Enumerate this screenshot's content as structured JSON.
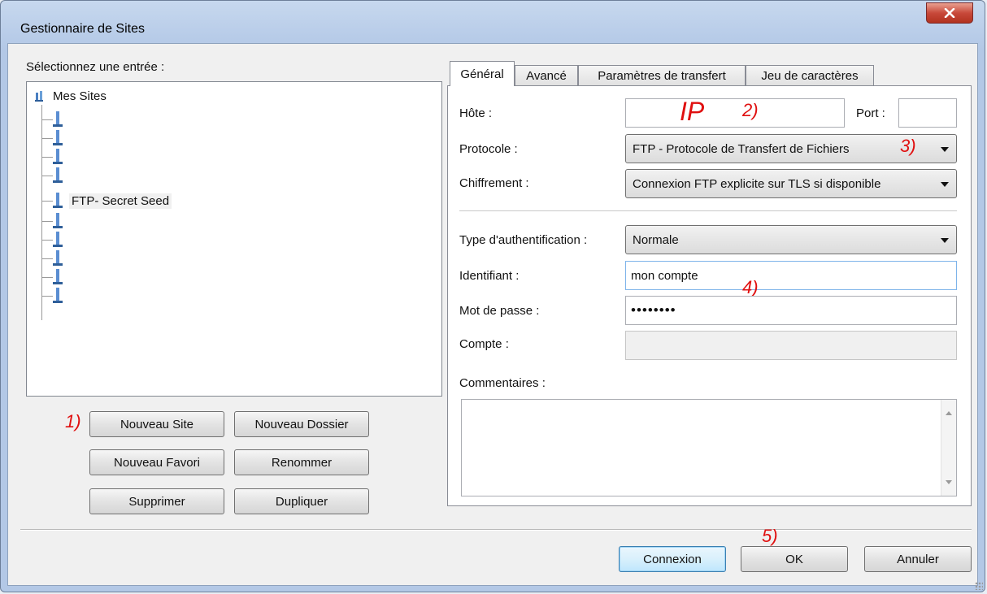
{
  "window": {
    "title": "Gestionnaire de Sites"
  },
  "left": {
    "select_label": "Sélectionnez une entrée :",
    "tree": {
      "root": "Mes Sites",
      "items": [
        "",
        "",
        "",
        "",
        "FTP- Secret Seed",
        "",
        "",
        "",
        "",
        ""
      ]
    },
    "buttons": {
      "new_site": "Nouveau Site",
      "new_folder": "Nouveau Dossier",
      "new_bookmark": "Nouveau Favori",
      "rename": "Renommer",
      "delete": "Supprimer",
      "duplicate": "Dupliquer"
    }
  },
  "tabs": [
    "Général",
    "Avancé",
    "Paramètres de transfert",
    "Jeu de caractères"
  ],
  "general": {
    "host_label": "Hôte :",
    "host_value": "",
    "port_label": "Port :",
    "port_value": "",
    "protocol_label": "Protocole :",
    "protocol_value": "FTP - Protocole de Transfert de Fichiers",
    "encryption_label": "Chiffrement :",
    "encryption_value": "Connexion FTP explicite sur TLS si disponible",
    "auth_type_label": "Type d'authentification :",
    "auth_type_value": "Normale",
    "user_label": "Identifiant :",
    "user_value": "mon compte",
    "password_label": "Mot de passe :",
    "password_value": "••••••••",
    "account_label": "Compte :",
    "account_value": "",
    "comments_label": "Commentaires :"
  },
  "footer": {
    "connect": "Connexion",
    "ok": "OK",
    "cancel": "Annuler"
  },
  "annotations": {
    "a1": "1)",
    "ip": "IP",
    "a2": "2)",
    "a3": "3)",
    "a4": "4)",
    "a5": "5)"
  },
  "colors": {
    "annotation": "#e01010",
    "title_bar": "#b9cde9",
    "close_button": "#c8493a"
  }
}
